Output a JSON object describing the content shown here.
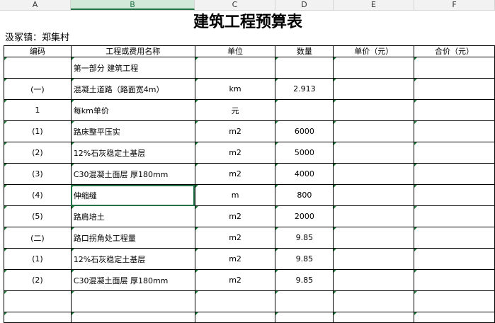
{
  "columns": [
    "A",
    "B",
    "C",
    "D",
    "E",
    "F"
  ],
  "selected_column": "B",
  "title": "建筑工程预算表",
  "town": "汲冢镇：郑集村",
  "headers": [
    "编码",
    "工程或费用名称",
    "单位",
    "数量",
    "单价（元）",
    "合价（元）"
  ],
  "rows": [
    {
      "code": "",
      "name": "第一部分 建筑工程",
      "unit": "",
      "qty": ""
    },
    {
      "code": "(一)",
      "name": "混凝土道路（路面宽4m）",
      "unit": "km",
      "qty": "2.913"
    },
    {
      "code": "1",
      "name": "每km单价",
      "unit": "元",
      "qty": ""
    },
    {
      "code": "(1)",
      "name": "路床整平压实",
      "unit": "m2",
      "qty": "6000"
    },
    {
      "code": "(2)",
      "name": "12%石灰稳定土基层",
      "unit": "m2",
      "qty": "5000"
    },
    {
      "code": "(3)",
      "name": "C30混凝土面层  厚180mm",
      "unit": "m2",
      "qty": "4000"
    },
    {
      "code": "(4)",
      "name": "伸缩缝",
      "unit": "m",
      "qty": "800"
    },
    {
      "code": "(5)",
      "name": "路肩培土",
      "unit": "m2",
      "qty": "2000"
    },
    {
      "code": "(二)",
      "name": "路口拐角处工程量",
      "unit": "m2",
      "qty": "9.85"
    },
    {
      "code": "(1)",
      "name": "12%石灰稳定土基层",
      "unit": "m2",
      "qty": "9.85"
    },
    {
      "code": "(2)",
      "name": "C30混凝土面层  厚180mm",
      "unit": "m2",
      "qty": "9.85"
    },
    {
      "code": "",
      "name": "",
      "unit": "",
      "qty": ""
    },
    {
      "code": "",
      "name": "",
      "unit": "",
      "qty": ""
    }
  ],
  "selected_cell": "B7",
  "colors": {
    "selection": "#217346",
    "header_bg": "#f2f2f2",
    "marker": "#1e7b3a"
  }
}
